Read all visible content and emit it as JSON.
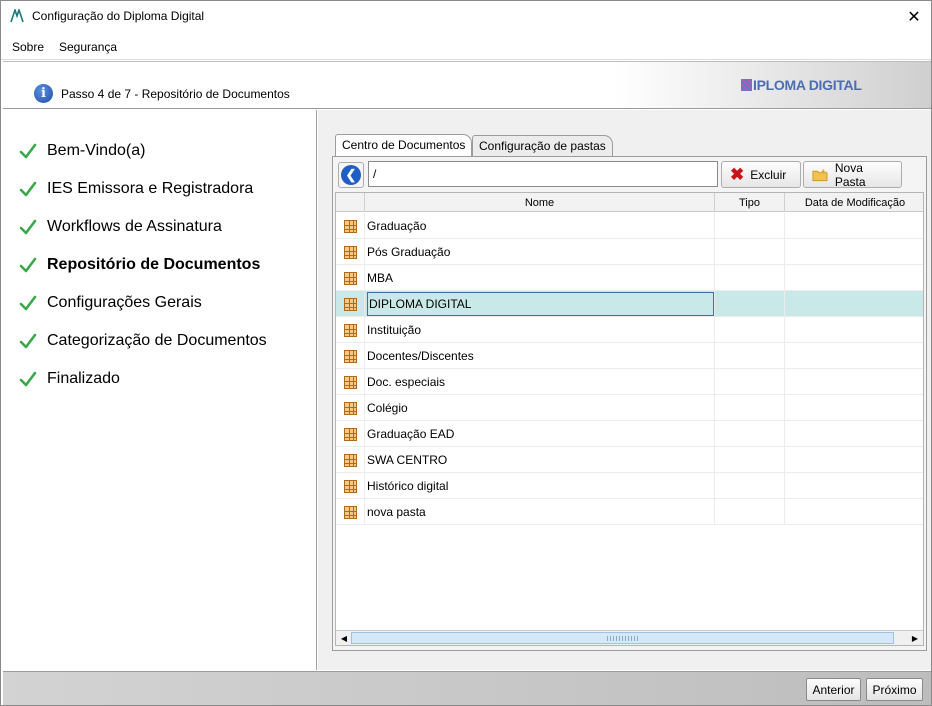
{
  "window": {
    "title": "Configuração do Diploma Digital",
    "close_glyph": "✕"
  },
  "menu": {
    "items": [
      "Sobre",
      "Segurança"
    ]
  },
  "header": {
    "step_text": "Passo 4 de 7 - Repositório de Documentos",
    "brand": "IPLOMA DIGITAL",
    "info_glyph": "i"
  },
  "nav": {
    "items": [
      {
        "label": "Bem-Vindo(a)",
        "active": false
      },
      {
        "label": "IES Emissora e Registradora",
        "active": false
      },
      {
        "label": "Workflows de Assinatura",
        "active": false
      },
      {
        "label": "Repositório de Documentos",
        "active": true
      },
      {
        "label": "Configurações Gerais",
        "active": false
      },
      {
        "label": "Categorização de Documentos",
        "active": false
      },
      {
        "label": "Finalizado",
        "active": false
      }
    ]
  },
  "tabs": [
    "Centro de Documentos",
    "Configuração de pastas"
  ],
  "toolbar": {
    "path": "/",
    "delete_label": "Excluir",
    "new_folder_label": "Nova Pasta",
    "back_glyph": "❮",
    "delete_glyph": "✖"
  },
  "table": {
    "columns": [
      "Nome",
      "Tipo",
      "Data de Modificação"
    ],
    "rows": [
      {
        "name": "Graduação",
        "tipo": "",
        "date": ""
      },
      {
        "name": "Pós Graduação",
        "tipo": "",
        "date": ""
      },
      {
        "name": "MBA",
        "tipo": "",
        "date": ""
      },
      {
        "name": "DIPLOMA DIGITAL",
        "tipo": "",
        "date": "",
        "selected": true
      },
      {
        "name": "Instituição",
        "tipo": "",
        "date": ""
      },
      {
        "name": "Docentes/Discentes",
        "tipo": "",
        "date": ""
      },
      {
        "name": "Doc. especiais",
        "tipo": "",
        "date": ""
      },
      {
        "name": "Colégio",
        "tipo": "",
        "date": ""
      },
      {
        "name": "Graduação EAD",
        "tipo": "",
        "date": ""
      },
      {
        "name": "SWA CENTRO",
        "tipo": "",
        "date": ""
      },
      {
        "name": "Histórico digital",
        "tipo": "",
        "date": ""
      },
      {
        "name": "nova pasta",
        "tipo": "",
        "date": ""
      }
    ]
  },
  "scrollbar": {
    "left_glyph": "◀",
    "right_glyph": "▶"
  },
  "footer": {
    "prev_label": "Anterior",
    "next_label": "Próximo"
  },
  "colors": {
    "accent": "#1f5fc4",
    "selected_row": "#c9e8e8",
    "check": "#3aa84a",
    "delete": "#c8151b"
  }
}
